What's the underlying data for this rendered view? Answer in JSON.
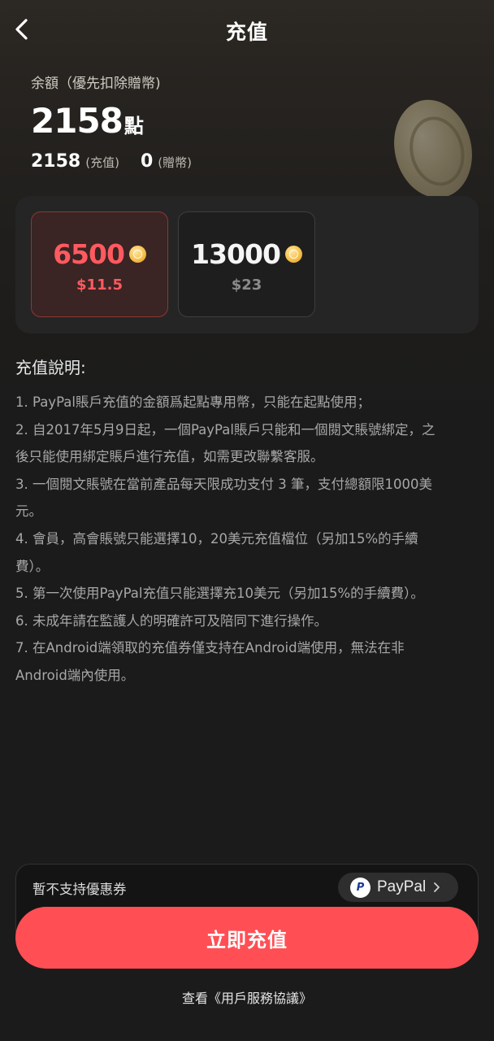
{
  "header": {
    "title": "充值",
    "back_icon": "chevron-left-icon"
  },
  "balance": {
    "label": "余額（優先扣除贈幣)",
    "amount": "2158",
    "unit": "點",
    "recharge_amount": "2158",
    "recharge_label": "(充值)",
    "gift_amount": "0",
    "gift_label": "(贈幣)"
  },
  "packages": [
    {
      "amount": "6500",
      "price": "$11.5",
      "selected": true
    },
    {
      "amount": "13000",
      "price": "$23",
      "selected": false
    }
  ],
  "description": {
    "title": "充值說明:",
    "lines": [
      "1. PayPal賬戶充值的金額爲起點專用幣，只能在起點使用；",
      "2. 自2017年5月9日起，一個PayPal賬戶只能和一個閱文賬號綁定，之",
      "後只能使用綁定賬戶進行充值，如需更改聯繫客服。",
      "3. 一個閱文賬號在當前產品每天限成功支付 3 筆，支付總額限1000美",
      "元。",
      "4. 會員，高會賬號只能選擇10，20美元充值檔位（另加15%的手續",
      "費）。",
      "5. 第一次使用PayPal充值只能選擇充10美元（另加15%的手續費）。",
      "6. 未成年請在監護人的明確許可及陪同下進行操作。",
      "7. 在Android端領取的充值券僅支持在Android端使用，無法在非",
      "Android端內使用。"
    ]
  },
  "payment": {
    "coupon_text": "暫不支持優惠券",
    "method": "PayPal",
    "method_icon": "paypal-icon"
  },
  "cta": {
    "label": "立即充值"
  },
  "agreement": {
    "label": "查看《用戶服務協議》"
  },
  "colors": {
    "accent": "#ff4f55",
    "selected_text": "#ff5a5f",
    "background": "#1b1b1b"
  }
}
